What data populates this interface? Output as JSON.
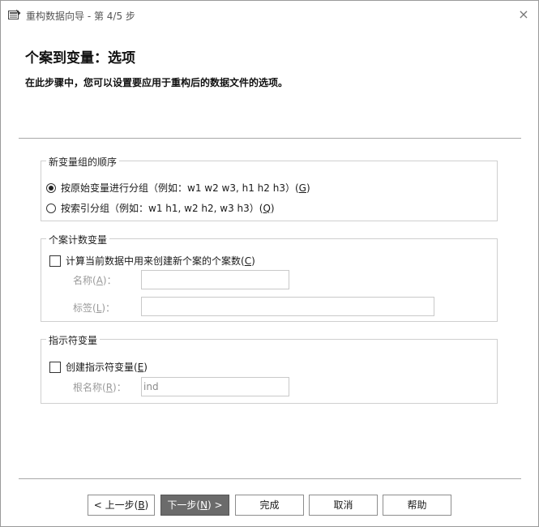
{
  "window": {
    "title": "重构数据向导 - 第 4/5 步",
    "close_glyph": "×"
  },
  "header": {
    "title": "个案到变量：选项",
    "subtitle": "在此步骤中，您可以设置要应用于重构后的数据文件的选项。"
  },
  "group_order": {
    "legend": "新变量组的顺序",
    "options": [
      {
        "label": "按原始变量进行分组（例如：w1 w2 w3, h1 h2 h3）(",
        "key": "G",
        "tail": ")",
        "selected": true
      },
      {
        "label": "按索引分组（例如：w1 h1, w2 h2, w3 h3）(",
        "key": "Q",
        "tail": ")",
        "selected": false
      }
    ]
  },
  "group_count": {
    "legend": "个案计数变量",
    "checkbox": {
      "label": "计算当前数据中用来创建新个案的个案数(",
      "key": "C",
      "tail": ")",
      "checked": false
    },
    "name_label": {
      "text": "名称(",
      "key": "A",
      "tail": ")："
    },
    "name_value": "",
    "tag_label": {
      "text": "标签(",
      "key": "L",
      "tail": ")："
    },
    "tag_value": ""
  },
  "group_indicator": {
    "legend": "指示符变量",
    "checkbox": {
      "label": "创建指示符变量(",
      "key": "E",
      "tail": ")",
      "checked": false
    },
    "root_label": {
      "text": "根名称(",
      "key": "R",
      "tail": ")："
    },
    "root_value": "ind"
  },
  "buttons": {
    "back": {
      "pre": "< 上一步(",
      "key": "B",
      "post": ")"
    },
    "next": {
      "pre": "下一步(",
      "key": "N",
      "post": ") >"
    },
    "finish": "完成",
    "cancel": "取消",
    "help": "帮助"
  }
}
